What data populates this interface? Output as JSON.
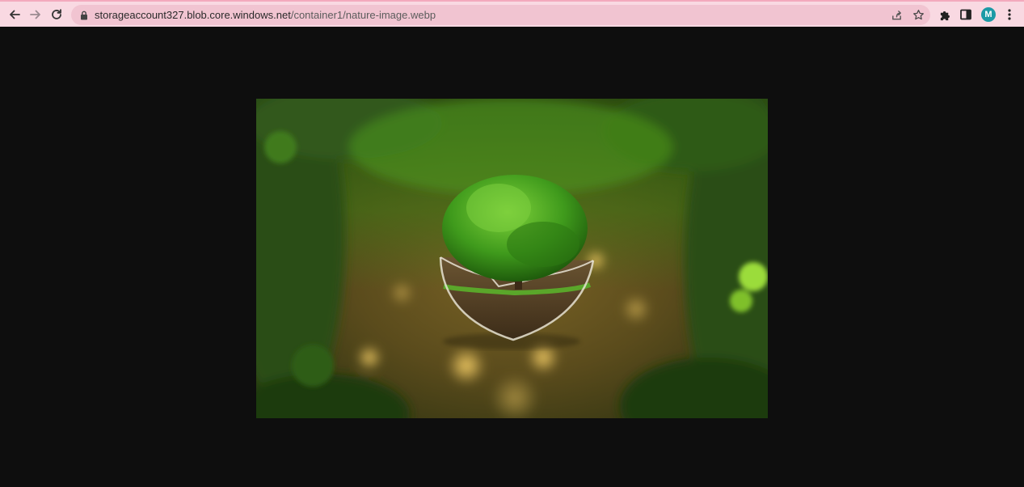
{
  "browser": {
    "url_host": "storageaccount327.blob.core.windows.net",
    "url_path": "/container1/nature-image.webp",
    "profile_initial": "M"
  },
  "icons": {
    "back": "back-arrow-icon",
    "forward": "forward-arrow-icon",
    "reload": "reload-icon",
    "lock": "lock-icon",
    "share": "share-icon",
    "bookmark": "star-icon",
    "extensions": "puzzle-icon",
    "side_panel": "side-panel-icon",
    "menu": "kebab-menu-icon"
  },
  "colors": {
    "toolbar": "#f9d9e2",
    "omnibox": "#f1c4d1",
    "page_background": "#0e0e0e",
    "avatar": "#1c9aa6"
  }
}
